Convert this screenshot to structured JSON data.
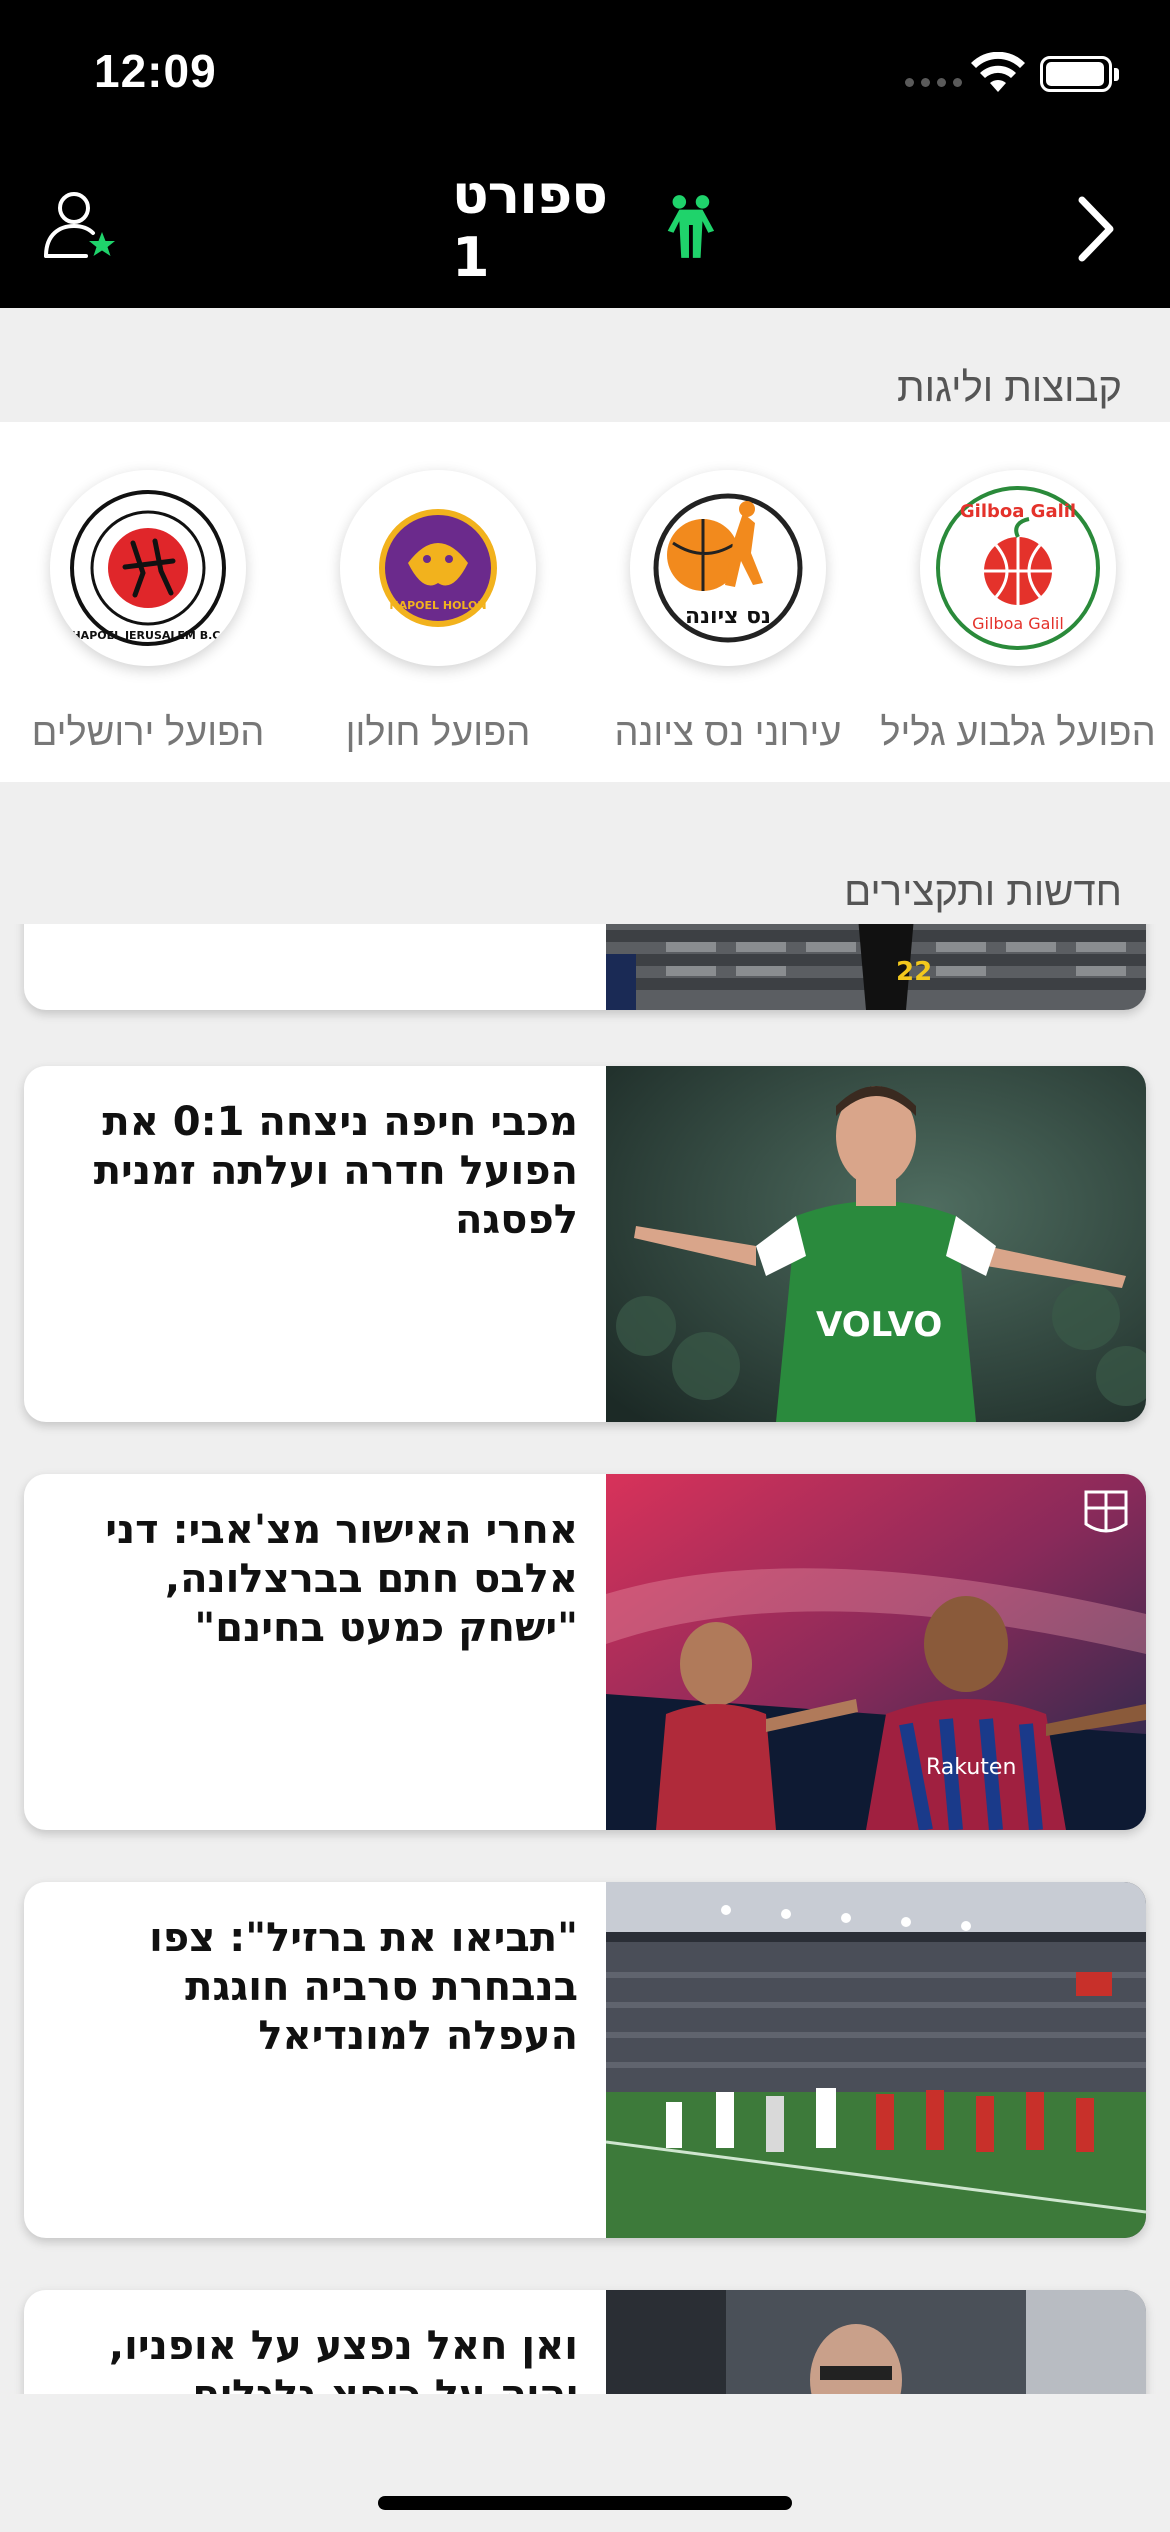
{
  "status_bar": {
    "time": "12:09"
  },
  "header": {
    "logo_text": "ספורט 1",
    "user_icon": "user-star-icon",
    "back_icon": "chevron-right-icon"
  },
  "teams_section": {
    "title": "קבוצות וליגות",
    "teams": [
      {
        "name": "הפועל גלבוע גליל",
        "logo": "gilboa-galil-logo",
        "logo_text": "Gilboa Galil"
      },
      {
        "name": "עירוני נס ציונה",
        "logo": "ironi-ness-ziona-logo",
        "logo_text": "נס ציונה"
      },
      {
        "name": "הפועל חולון",
        "logo": "hapoel-holon-logo",
        "logo_text": "HAPOEL HOLON"
      },
      {
        "name": "הפועל ירושלים",
        "logo": "hapoel-jerusalem-logo",
        "logo_text": "HAPOEL JERUSALEM B.C."
      }
    ]
  },
  "news_section": {
    "title": "חדשות ותקצירים",
    "items": [
      {
        "title": "",
        "image": "stadium-player-photo"
      },
      {
        "title": "מכבי חיפה ניצחה 0:1 את הפועל חדרה ועלתה זמנית לפסגה",
        "image": "maccabi-haifa-player-photo"
      },
      {
        "title": "אחרי האישור מצ'אבי: דני אלבס חתם בברצלונה, \"ישחק כמעט בחינם\"",
        "image": "barcelona-players-photo"
      },
      {
        "title": "\"תביאו את ברזיל\": צפו בנבחרת סרביה חוגגת העפלה למונדיאל",
        "image": "serbia-celebration-photo"
      },
      {
        "title": "ואן חאל נפצע על אופניו, יהיה על כיסא גלגלים",
        "image": "van-gaal-photo"
      }
    ]
  },
  "colors": {
    "header_bg": "#000000",
    "accent_green": "#1fd36b",
    "page_bg": "#efefef"
  }
}
